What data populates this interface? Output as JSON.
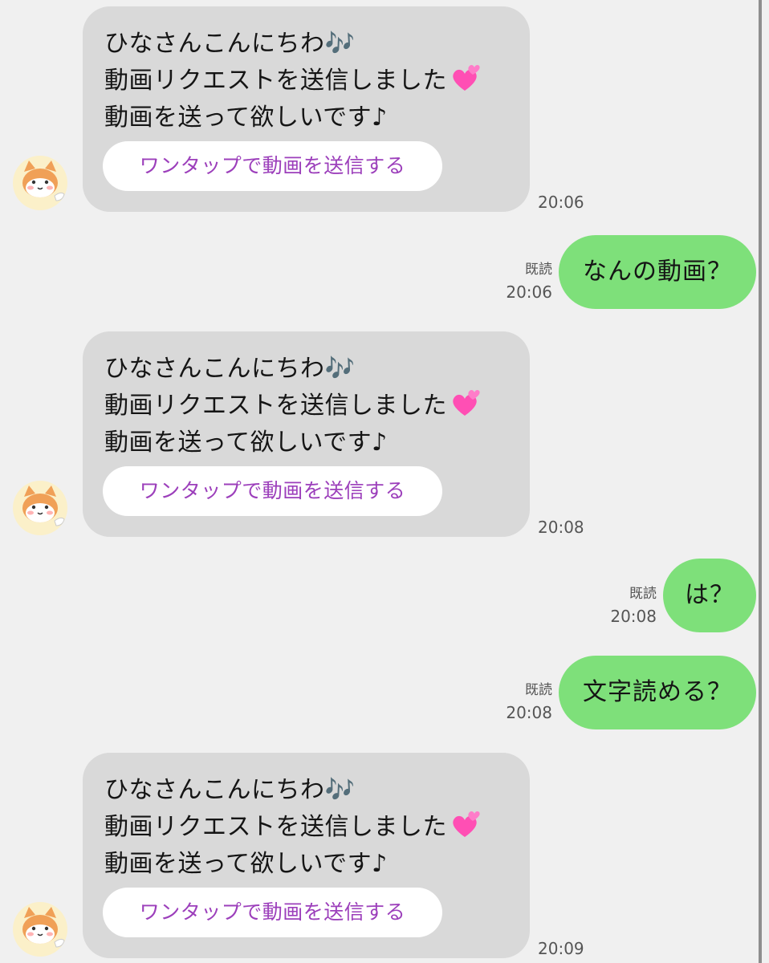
{
  "messages": {
    "incoming": {
      "line1": "ひなさんこんにちわ🎶",
      "line2": "動画リクエストを送信しました",
      "line3": "動画を送って欲しいです♪",
      "button": "ワンタップで動画を送信する",
      "heart_icon": "two-hearts-icon",
      "heart_color": "#ff4fb4",
      "avatar_icon": "shiba-dog-icon"
    },
    "times": {
      "m1": "20:06",
      "m2": "20:06",
      "m3": "20:08",
      "m4": "20:08",
      "m5": "20:08",
      "m6": "20:09"
    },
    "outgoing": {
      "read_label": "既読",
      "m2_text": "なんの動画？",
      "m4_text": "は？",
      "m5_text": "文字読める？"
    }
  },
  "colors": {
    "background": "#f0f0f0",
    "incoming_bubble": "#d9d9d9",
    "outgoing_bubble": "#7ee07a",
    "button_text": "#9c3fbb"
  }
}
